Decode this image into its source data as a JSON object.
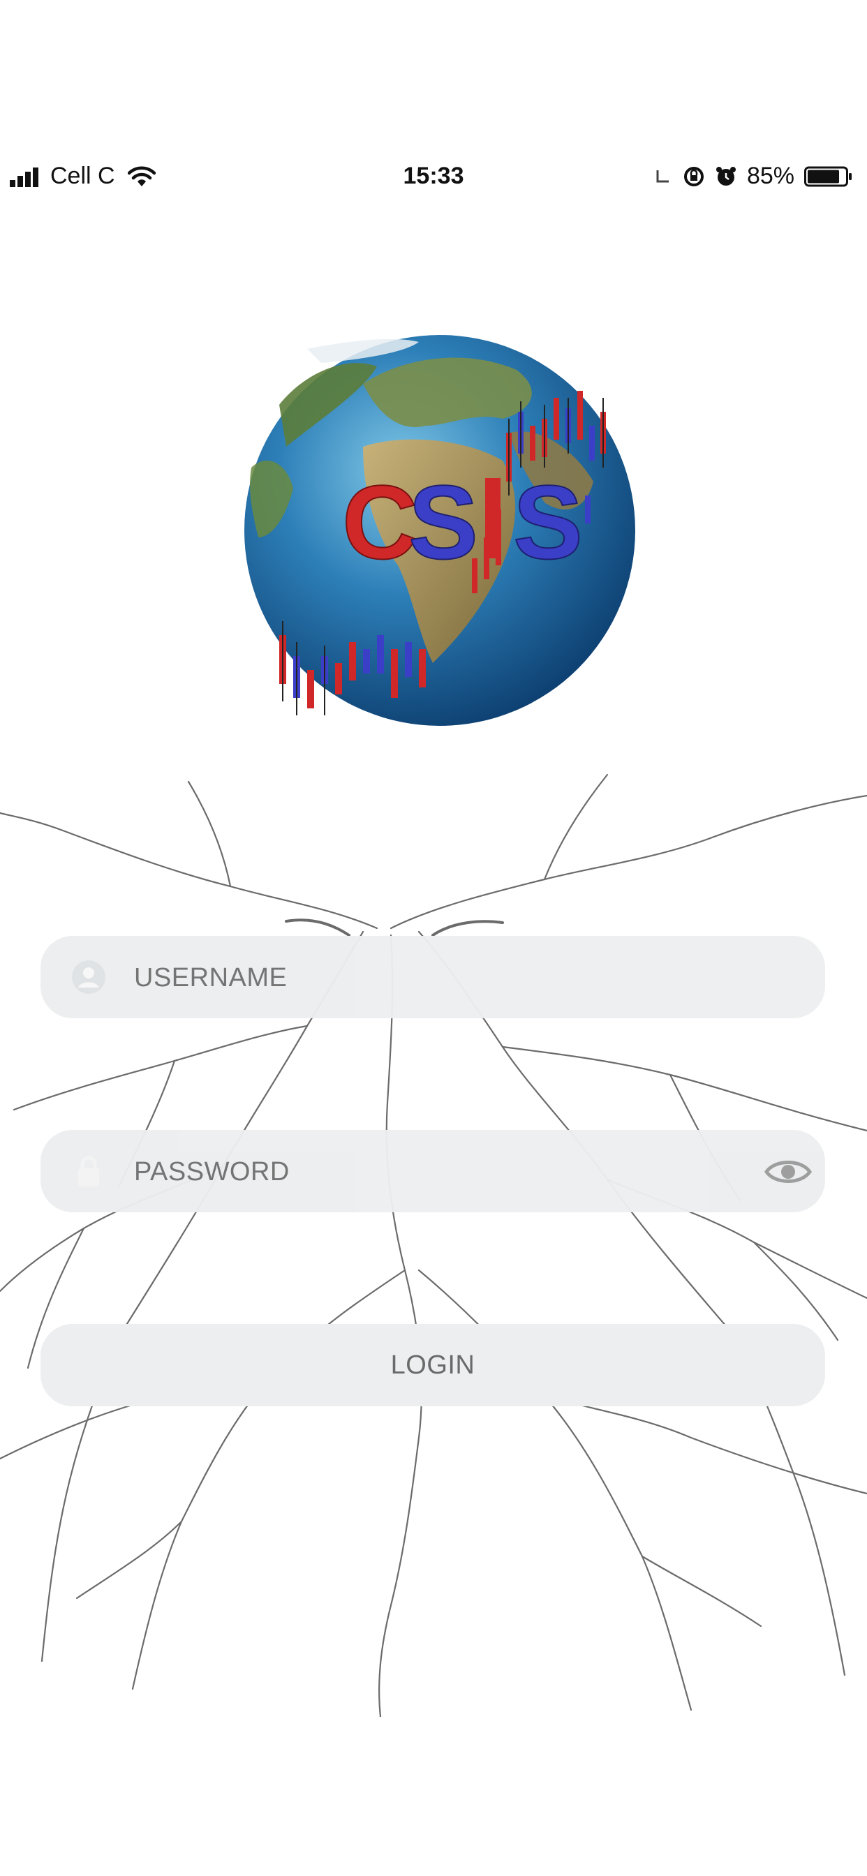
{
  "status_bar": {
    "carrier": "Cell C",
    "time": "15:33",
    "battery": "85%",
    "battery_level": 0.85
  },
  "logo": {
    "text": "CSIS",
    "colors": {
      "ocean": "#1e6aa8",
      "land": "#b59a5e",
      "red": "#d02828",
      "blue": "#3b3fc8"
    }
  },
  "form": {
    "username_placeholder": "USERNAME",
    "password_placeholder": "PASSWORD",
    "login_label": "LOGIN"
  },
  "icons": {
    "signal": "signal-bars-icon",
    "wifi": "wifi-icon",
    "moon": "moon-icon",
    "rotation_lock": "rotation-lock-icon",
    "alarm": "alarm-icon",
    "battery": "battery-icon",
    "user": "user-icon",
    "lock": "lock-icon",
    "eye": "eye-icon"
  }
}
